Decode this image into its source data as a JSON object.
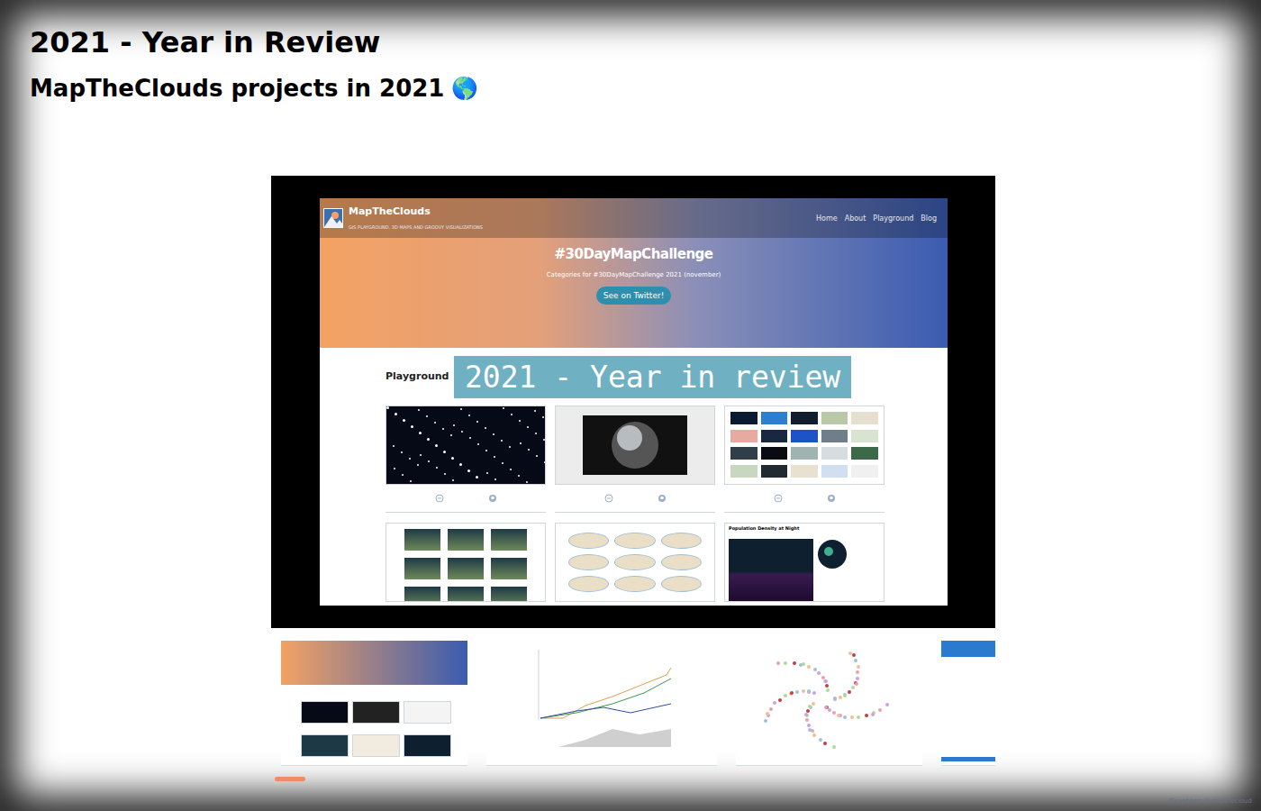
{
  "page": {
    "title": "2021 - Year in Review",
    "subtitle": "MapTheClouds projects in 2021",
    "subtitle_icon": "🌎"
  },
  "slide": {
    "site": {
      "name": "MapTheClouds",
      "tagline": "GIS PLAYGROUND, 3D MAPS AND GROOVY VISUALIZATIONS",
      "nav": [
        "Home",
        "About",
        "Playground",
        "Blog"
      ]
    },
    "hero": {
      "title": "#30DayMapChallenge",
      "text": "Categories for #30DayMapChallenge 2021 (november)",
      "button": "See on Twitter!"
    },
    "section": "Playground",
    "caption": "2021 - Year in review",
    "cards": [
      {
        "kind": "stars",
        "has_links": true
      },
      {
        "kind": "globe",
        "has_links": true
      },
      {
        "kind": "gallery",
        "has_links": true
      },
      {
        "kind": "terrain",
        "has_links": false
      },
      {
        "kind": "projections",
        "has_links": false
      },
      {
        "kind": "nightmap",
        "has_links": false,
        "title": "Population Density at Night"
      }
    ]
  },
  "thumbnails": [
    {
      "kind": "site",
      "selected": true
    },
    {
      "kind": "chart",
      "selected": false
    },
    {
      "kind": "network",
      "selected": false
    },
    {
      "kind": "page",
      "selected": false
    }
  ],
  "credit": {
    "label": "Graphics:",
    "handle": "@mapthecloud"
  }
}
